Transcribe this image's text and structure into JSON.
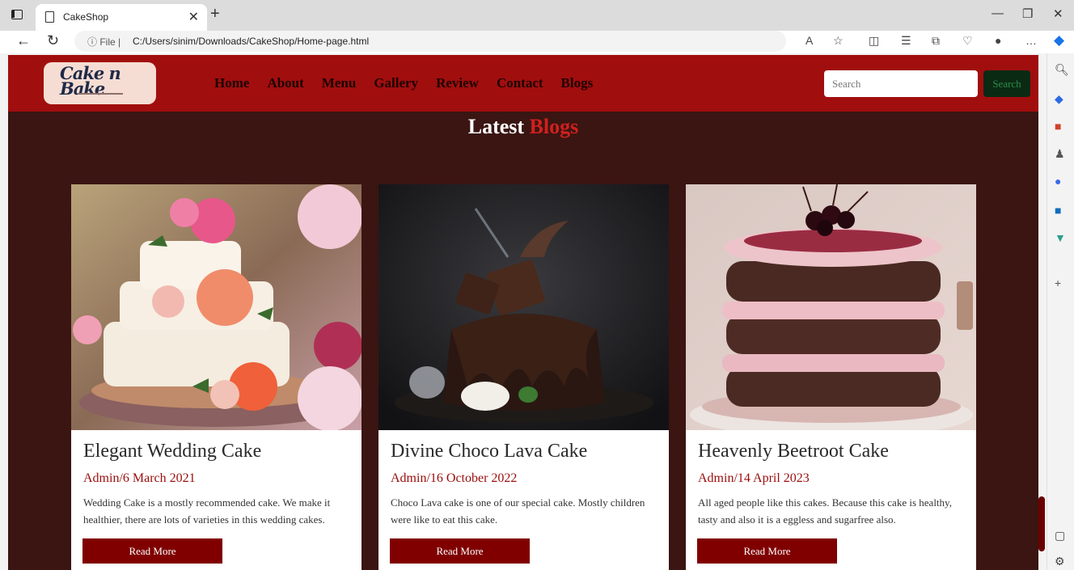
{
  "browser": {
    "tab_title": "CakeShop",
    "url_info": "ⓘ File  |",
    "url": "C:/Users/sinim/Downloads/CakeShop/Home-page.html"
  },
  "site": {
    "logo_text": "Cake n Bake",
    "nav": [
      "Home",
      "About",
      "Menu",
      "Gallery",
      "Review",
      "Contact",
      "Blogs"
    ],
    "search_placeholder": "Search",
    "search_button": "Search"
  },
  "section": {
    "title_main": "Latest",
    "title_accent": "Blogs"
  },
  "cards": [
    {
      "title": "Elegant Wedding Cake",
      "meta": "Admin/6 March 2021",
      "text": "Wedding Cake is a mostly recommended cake. We make it healthier, there are lots of varieties in this wedding cakes.",
      "button": "Read More"
    },
    {
      "title": "Divine Choco Lava Cake",
      "meta": "Admin/16 October 2022",
      "text": "Choco Lava cake is one of our special cake. Mostly children were like to eat this cake.",
      "button": "Read More"
    },
    {
      "title": "Heavenly Beetroot Cake",
      "meta": "Admin/14 April 2023",
      "text": "All aged people like this cakes. Because this cake is healthy, tasty and also it is a eggless and sugarfree also.",
      "button": "Read More"
    }
  ],
  "colors": {
    "navbar": "#a10e0e",
    "page_bg": "#3a1512",
    "accent": "#d0201e",
    "button": "#800000",
    "meta": "#9b0c0c"
  }
}
